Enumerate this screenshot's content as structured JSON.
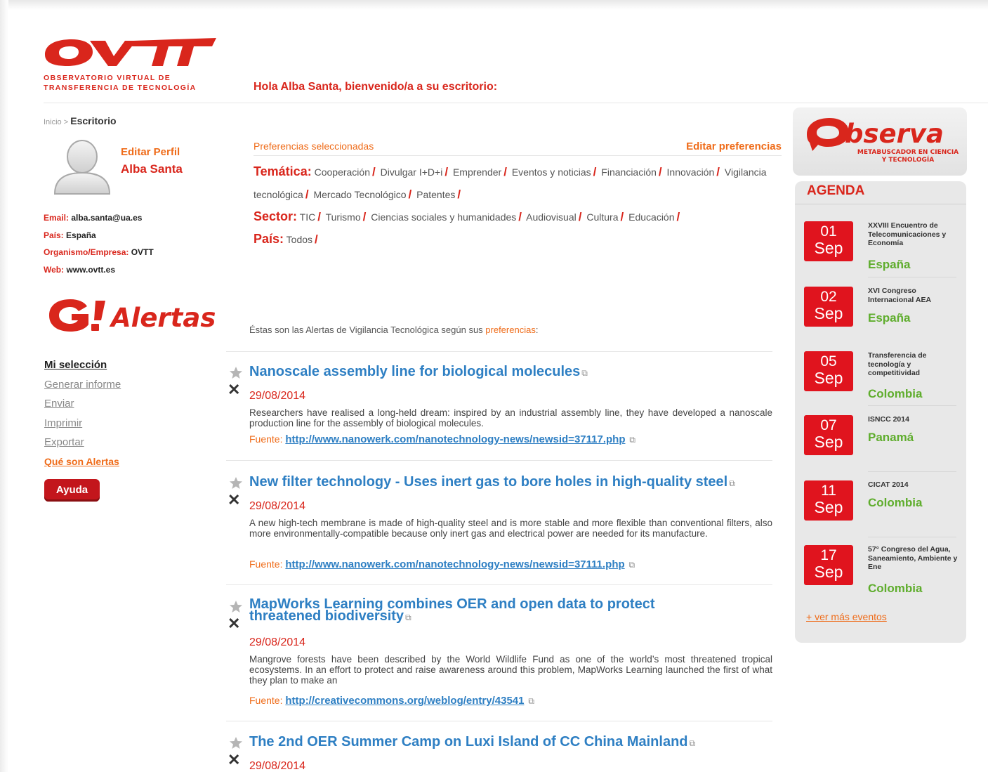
{
  "header": {
    "logo_sub_line1": "OBSERVATORIO VIRTUAL DE",
    "logo_sub_line2": "TRANSFERENCIA DE TECNOLOGÍA",
    "welcome": "Hola Alba Santa, bienvenido/a a su escritorio:"
  },
  "breadcrumb": {
    "home": "Inicio",
    "sep": ">",
    "current": "Escritorio"
  },
  "profile": {
    "edit_label": "Editar Perfil",
    "name": "Alba Santa",
    "email_label": "Email:",
    "email": "alba.santa@ua.es",
    "country_label": "País:",
    "country": "España",
    "org_label": "Organismo/Empresa:",
    "org": "OVTT",
    "web_label": "Web:",
    "web": "www.ovtt.es"
  },
  "preferences": {
    "title": "Preferencias seleccionadas",
    "edit_label": "Editar preferencias",
    "tematica_label": "Temática:",
    "tematica": [
      "Cooperación",
      "Divulgar I+D+i",
      "Emprender",
      "Eventos y noticias",
      "Financiación",
      "Innovación",
      "Vigilancia tecnológica",
      "Mercado Tecnológico",
      "Patentes"
    ],
    "sector_label": "Sector:",
    "sector": [
      "TIC",
      "Turismo",
      "Ciencias sociales y humanidades",
      "Audiovisual",
      "Cultura",
      "Educación"
    ],
    "pais_label": "País:",
    "pais": [
      "Todos"
    ]
  },
  "alertas": {
    "intro": "Éstas son las Alertas de Vigilancia Tecnológica según sus ",
    "intro_link": "preferencias",
    "intro_end": ":"
  },
  "side_menu": {
    "mi_seleccion": "Mi selección",
    "generar": "Generar informe",
    "enviar": "Enviar",
    "imprimir": "Imprimir",
    "exportar": "Exportar",
    "que_son": "Qué son Alertas",
    "ayuda": "Ayuda"
  },
  "alerts": [
    {
      "title": "Nanoscale assembly line for biological molecules",
      "date": "29/08/2014",
      "desc": "Researchers have realised a long-held dream: inspired by an industrial assembly line, they have developed a nanoscale production line for the assembly of biological molecules.",
      "source_label": "Fuente:",
      "source_url": "http://www.nanowerk.com/nanotechnology-news/newsid=37117.php"
    },
    {
      "title": "New filter technology - Uses inert gas to bore holes in high-quality steel",
      "date": "29/08/2014",
      "desc": "A new high-tech membrane is made of high-quality steel and is more stable and more flexible than conventional filters, also more environmentally-compatible because only inert gas and electrical power are needed for its manufacture.",
      "source_label": "Fuente:",
      "source_url": "http://www.nanowerk.com/nanotechnology-news/newsid=37111.php"
    },
    {
      "title_line1": "MapWorks Learning combines OER and open data to protect",
      "title_line2": "threatened biodiversity",
      "date": "29/08/2014",
      "desc": "Mangrove forests have been described by the World Wildlife Fund as one of the world’s most threatened tropical ecosystems. In an effort to protect and raise awareness around this problem, MapWorks Learning launched the first of what they plan to make an",
      "source_label": "Fuente:",
      "source_url": "http://creativecommons.org/weblog/entry/43541"
    },
    {
      "title": "The 2nd OER Summer Camp on Luxi Island of CC China Mainland",
      "date": "29/08/2014"
    }
  ],
  "observa": {
    "word": "bserva",
    "sub1": "METABUSCADOR EN CIENCIA",
    "sub2": "Y TECNOLOGÍA"
  },
  "agenda": {
    "title": "AGENDA",
    "events": [
      {
        "day": "01",
        "month": "Sep",
        "name": "XXVIII Encuentro de Telecomunicaciones y Economía",
        "country": "España"
      },
      {
        "day": "02",
        "month": "Sep",
        "name": "XVI Congreso Internacional AEA",
        "country": "España"
      },
      {
        "day": "05",
        "month": "Sep",
        "name": "Transferencia de tecnología y competitividad",
        "country": "Colombia"
      },
      {
        "day": "07",
        "month": "Sep",
        "name": "ISNCC 2014",
        "country": "Panamá"
      },
      {
        "day": "11",
        "month": "Sep",
        "name": "CICAT 2014",
        "country": "Colombia"
      },
      {
        "day": "17",
        "month": "Sep",
        "name": "57° Congreso del Agua, Saneamiento, Ambiente y Ene",
        "country": "Colombia"
      }
    ],
    "more": "+ ver más eventos"
  },
  "colors": {
    "red": "#d9261c",
    "orange": "#ef6c1a",
    "blue": "#2e7fc3",
    "green": "#5fad2d"
  }
}
